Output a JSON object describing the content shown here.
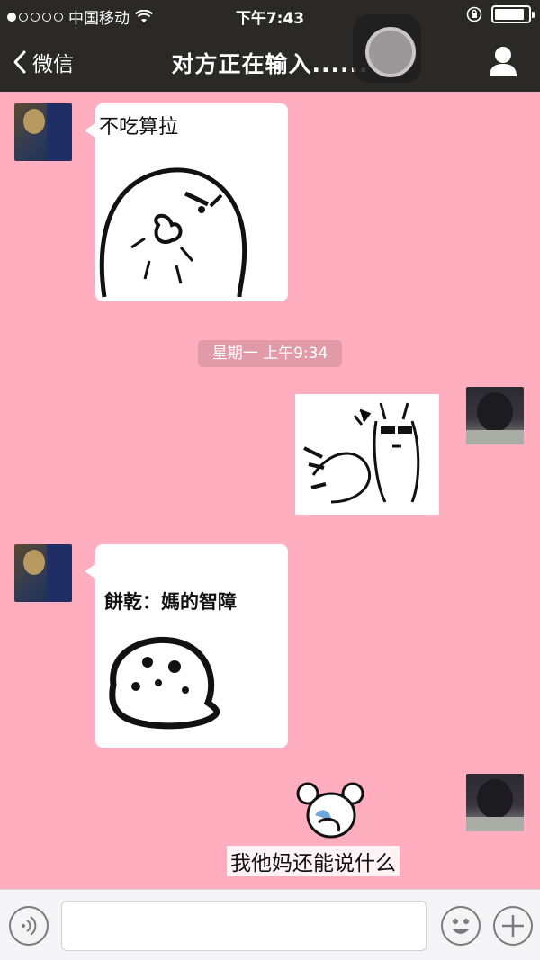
{
  "status_bar": {
    "carrier": "中国移动",
    "time": "下午7:43",
    "signal_dots_filled": 1,
    "signal_dots_total": 5,
    "battery_level": 0.9
  },
  "nav": {
    "back_label": "微信",
    "title": "对方正在输入......"
  },
  "messages": [
    {
      "side": "left",
      "type": "sticker",
      "caption": "不吃算拉"
    },
    {
      "type": "timestamp",
      "text": "星期一 上午9:34"
    },
    {
      "side": "right",
      "type": "sticker"
    },
    {
      "side": "left",
      "type": "sticker",
      "caption": "餅乾：媽的智障"
    },
    {
      "side": "right",
      "type": "sticker",
      "caption": "我他妈还能说什么"
    }
  ],
  "input_bar": {
    "message_value": "",
    "voice_icon": "voice-icon",
    "emoji_icon": "emoji-icon",
    "plus_icon": "plus-icon"
  },
  "colors": {
    "chat_background": "#ffaebf",
    "header_background": "#2b2828",
    "bubble": "#ffffff"
  }
}
